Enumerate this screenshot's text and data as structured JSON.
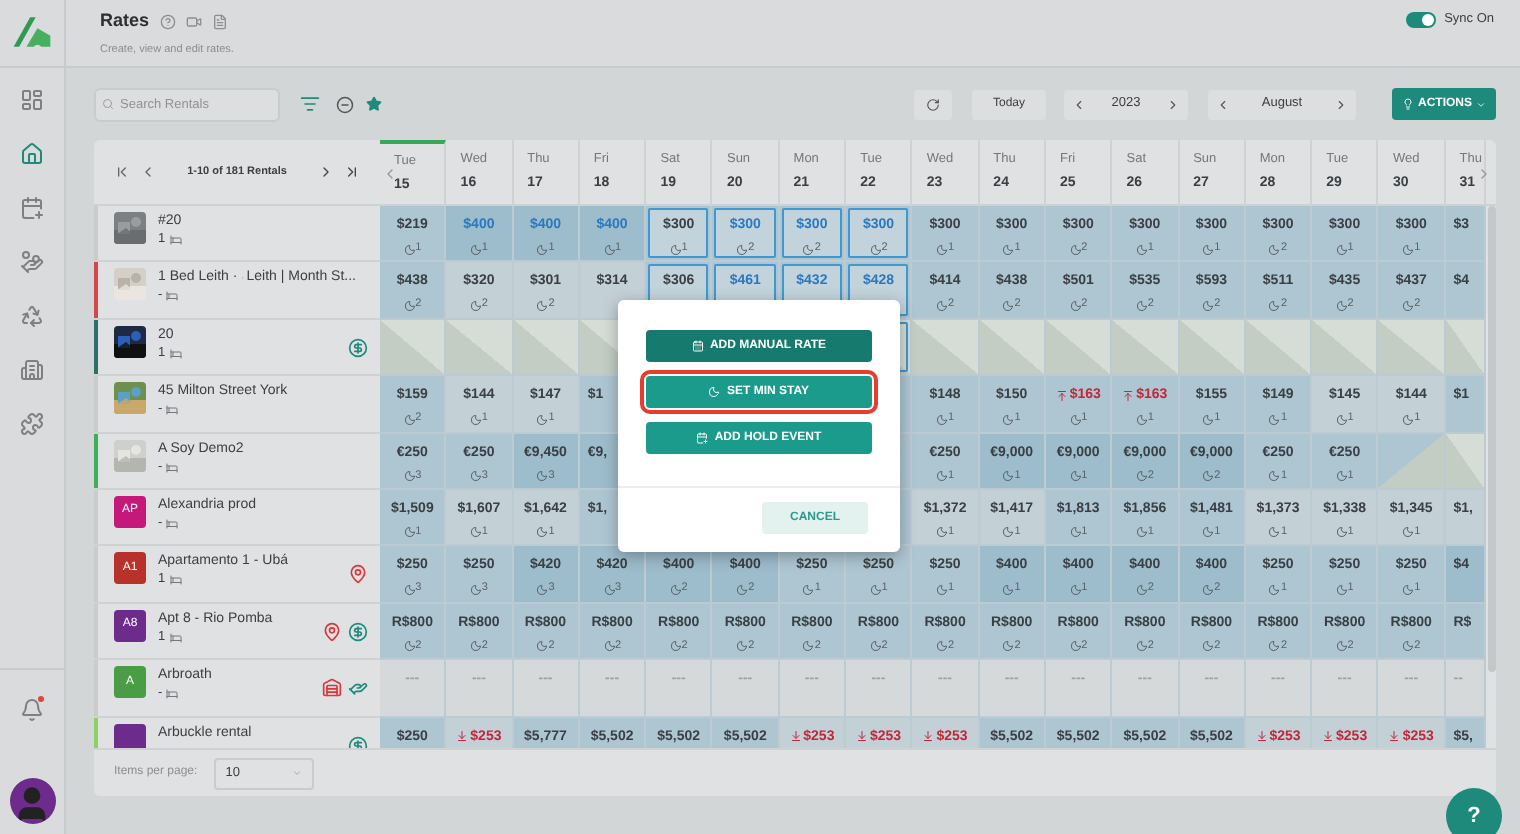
{
  "page": {
    "title": "Rates",
    "subtitle": "Create, view and edit rates.",
    "sync": {
      "label": "Sync On",
      "on": true
    }
  },
  "sidebar": {
    "items": [
      {
        "kind": "dashboard",
        "selected": false
      },
      {
        "kind": "home",
        "selected": true
      },
      {
        "kind": "calendar",
        "selected": false
      },
      {
        "kind": "coins",
        "selected": false
      },
      {
        "kind": "recycle",
        "selected": false
      },
      {
        "kind": "building",
        "selected": false
      },
      {
        "kind": "puzzle",
        "selected": false
      }
    ],
    "notifications": {
      "unread": true
    }
  },
  "toolbar": {
    "search": {
      "placeholder": "Search Rentals"
    },
    "today": "Today",
    "year": "2023",
    "month": "August",
    "actions": "ACTIONS"
  },
  "pager": {
    "label": "1-10 of 181 Rentals"
  },
  "columns": [
    {
      "day": "Tue",
      "date": "15",
      "today": true
    },
    {
      "day": "Wed",
      "date": "16",
      "today": false
    },
    {
      "day": "Thu",
      "date": "17",
      "today": false
    },
    {
      "day": "Fri",
      "date": "18",
      "today": false
    },
    {
      "day": "Sat",
      "date": "19",
      "today": false
    },
    {
      "day": "Sun",
      "date": "20",
      "today": false
    },
    {
      "day": "Mon",
      "date": "21",
      "today": false
    },
    {
      "day": "Tue",
      "date": "22",
      "today": false
    },
    {
      "day": "Wed",
      "date": "23",
      "today": false
    },
    {
      "day": "Thu",
      "date": "24",
      "today": false
    },
    {
      "day": "Fri",
      "date": "25",
      "today": false
    },
    {
      "day": "Sat",
      "date": "26",
      "today": false
    },
    {
      "day": "Sun",
      "date": "27",
      "today": false
    },
    {
      "day": "Mon",
      "date": "28",
      "today": false
    },
    {
      "day": "Tue",
      "date": "29",
      "today": false
    },
    {
      "day": "Wed",
      "date": "30",
      "today": false
    },
    {
      "day": "Thu",
      "date": "31",
      "today": false
    }
  ],
  "rentals": [
    {
      "name": "#20",
      "count": "1",
      "avatar": {
        "kind": "picture"
      },
      "color": "#c9cbcc",
      "cells": [
        {
          "price": "$219",
          "min": "1",
          "kind": "base",
          "selected": false
        },
        {
          "price": "$400",
          "min": "1",
          "kind": "high_manual",
          "selected": false
        },
        {
          "price": "$400",
          "min": "1",
          "kind": "high_manual",
          "selected": false
        },
        {
          "price": "$400",
          "min": "1",
          "kind": "high_manual",
          "selected": false
        },
        {
          "price": "$300",
          "min": "1",
          "kind": "base",
          "selected": true
        },
        {
          "price": "$300",
          "min": "2",
          "kind": "base_manual",
          "selected": true
        },
        {
          "price": "$300",
          "min": "2",
          "kind": "base_manual",
          "selected": true
        },
        {
          "price": "$300",
          "min": "2",
          "kind": "base_manual",
          "selected": true
        },
        {
          "price": "$300",
          "min": "1",
          "kind": "base",
          "selected": false
        },
        {
          "price": "$300",
          "min": "1",
          "kind": "base",
          "selected": false
        },
        {
          "price": "$300",
          "min": "2",
          "kind": "base",
          "selected": false
        },
        {
          "price": "$300",
          "min": "1",
          "kind": "base",
          "selected": false
        },
        {
          "price": "$300",
          "min": "1",
          "kind": "base",
          "selected": false
        },
        {
          "price": "$300",
          "min": "2",
          "kind": "base",
          "selected": false
        },
        {
          "price": "$300",
          "min": "1",
          "kind": "base",
          "selected": false
        },
        {
          "price": "$300",
          "min": "1",
          "kind": "base",
          "selected": false
        },
        {
          "price": "$3",
          "kind": "base",
          "selected": false
        }
      ]
    },
    {
      "name": "1 Bed Leith ·",
      "channel": "Leith | Month St...",
      "count": "-",
      "avatar": {
        "kind": "picture"
      },
      "color": "#d6464a",
      "cells": [
        {
          "price": "$438",
          "min": "2",
          "kind": "base",
          "selected": false
        },
        {
          "price": "$320",
          "min": "2",
          "kind": "light",
          "selected": false
        },
        {
          "price": "$301",
          "min": "2",
          "kind": "light",
          "selected": false
        },
        {
          "price": "$314",
          "kind": "light",
          "selected": false
        },
        {
          "price": "$306",
          "kind": "base",
          "selected": true
        },
        {
          "price": "$461",
          "kind": "base_manual",
          "selected": true
        },
        {
          "price": "$432",
          "kind": "base_manual",
          "selected": true
        },
        {
          "price": "$428",
          "kind": "base_manual",
          "selected": true
        },
        {
          "price": "$414",
          "min": "2",
          "kind": "base",
          "selected": false
        },
        {
          "price": "$438",
          "min": "2",
          "kind": "base",
          "selected": false
        },
        {
          "price": "$501",
          "min": "2",
          "kind": "base",
          "selected": false
        },
        {
          "price": "$535",
          "min": "2",
          "kind": "base",
          "selected": false
        },
        {
          "price": "$593",
          "min": "2",
          "kind": "base",
          "selected": false
        },
        {
          "price": "$511",
          "min": "2",
          "kind": "base",
          "selected": false
        },
        {
          "price": "$435",
          "min": "2",
          "kind": "base",
          "selected": false
        },
        {
          "price": "$437",
          "min": "2",
          "kind": "base",
          "selected": false
        },
        {
          "price": "$4",
          "kind": "base",
          "selected": false
        }
      ]
    },
    {
      "name": "20",
      "count": "1",
      "avatar": {
        "kind": "picture"
      },
      "color": "#2f6e68",
      "badges": [
        {
          "kind": "dollar"
        }
      ],
      "cells": [
        {
          "kind": "hatch",
          "selected": false
        },
        {
          "kind": "hatch",
          "selected": false
        },
        {
          "kind": "hatch",
          "selected": false
        },
        {
          "kind": "hatch",
          "selected": false
        },
        {
          "kind": "hatch",
          "selected": true
        },
        {
          "kind": "hatch",
          "selected": false
        },
        {
          "kind": "hatch",
          "selected": false
        },
        {
          "kind": "hatch",
          "selected": false
        },
        {
          "kind": "hatch",
          "selected": false
        },
        {
          "kind": "hatch",
          "selected": false
        },
        {
          "kind": "hatch",
          "selected": false
        },
        {
          "kind": "hatch",
          "selected": false
        },
        {
          "kind": "hatch",
          "selected": false
        },
        {
          "kind": "hatch",
          "selected": false
        }
      ]
    },
    {
      "name": "45 Milton Street York",
      "count": "-",
      "avatar": {
        "kind": "picture"
      },
      "color": "#c9cbcc",
      "cells": [
        {
          "price": "$159",
          "min": "2",
          "kind": "base",
          "selected": false
        },
        {
          "price": "$144",
          "min": "1",
          "kind": "light",
          "selected": false
        },
        {
          "price": "$147",
          "min": "1",
          "kind": "light",
          "selected": false
        },
        {
          "price": "$1",
          "kind": "base",
          "selected": false
        },
        {
          "price": "$148",
          "min": "1",
          "kind": "base",
          "selected": false
        },
        {
          "price": "$150",
          "min": "1",
          "kind": "base",
          "selected": false
        },
        {
          "price": "$163",
          "min": "1",
          "kind": "base_up",
          "selected": false
        },
        {
          "price": "$163",
          "min": "1",
          "kind": "base_up",
          "selected": false
        },
        {
          "price": "$155",
          "min": "1",
          "kind": "base",
          "selected": false
        },
        {
          "price": "$149",
          "min": "1",
          "kind": "base",
          "selected": false
        },
        {
          "price": "$145",
          "min": "1",
          "kind": "light",
          "selected": false
        },
        {
          "price": "$144",
          "min": "1",
          "kind": "light",
          "selected": false
        },
        {
          "price": "$1",
          "kind": "base",
          "selected": false
        }
      ]
    },
    {
      "name": "A Soy Demo2",
      "count": "-",
      "avatar": {
        "kind": "picture"
      },
      "color": "#3cb15a",
      "cells": [
        {
          "price": "€250",
          "min": "3",
          "kind": "base",
          "selected": false
        },
        {
          "price": "€250",
          "min": "3",
          "kind": "base",
          "selected": false
        },
        {
          "price": "€9,450",
          "min": "3",
          "kind": "high",
          "selected": false
        },
        {
          "price": "€9,",
          "kind": "high",
          "selected": false
        },
        {
          "price": "€250",
          "min": "1",
          "kind": "base",
          "selected": false
        },
        {
          "price": "€9,000",
          "min": "1",
          "kind": "high",
          "selected": false
        },
        {
          "price": "€9,000",
          "min": "1",
          "kind": "high",
          "selected": false
        },
        {
          "price": "€9,000",
          "min": "2",
          "kind": "high",
          "selected": false
        },
        {
          "price": "€9,000",
          "min": "2",
          "kind": "high",
          "selected": false
        },
        {
          "price": "€250",
          "min": "1",
          "kind": "base",
          "selected": false
        },
        {
          "price": "€250",
          "min": "1",
          "kind": "base",
          "selected": false
        },
        {
          "kind": "half_hatch",
          "selected": false
        },
        {
          "kind": "hatch",
          "selected": false
        }
      ]
    },
    {
      "name": "Alexandria prod",
      "count": "-",
      "avatar": {
        "kind": "initials",
        "initials": "AP",
        "color": "#c4197a"
      },
      "color": "#c9cbcc",
      "cells": [
        {
          "price": "$1,509",
          "min": "1",
          "kind": "base",
          "selected": false
        },
        {
          "price": "$1,607",
          "min": "1",
          "kind": "light",
          "selected": false
        },
        {
          "price": "$1,642",
          "min": "1",
          "kind": "light",
          "selected": false
        },
        {
          "price": "$1,",
          "kind": "base",
          "selected": false
        },
        {
          "price": "$1,372",
          "min": "1",
          "kind": "light",
          "selected": false
        },
        {
          "price": "$1,417",
          "min": "1",
          "kind": "light",
          "selected": false
        },
        {
          "price": "$1,813",
          "min": "1",
          "kind": "base",
          "selected": false
        },
        {
          "price": "$1,856",
          "min": "1",
          "kind": "base",
          "selected": false
        },
        {
          "price": "$1,481",
          "min": "1",
          "kind": "base",
          "selected": false
        },
        {
          "price": "$1,373",
          "min": "1",
          "kind": "light",
          "selected": false
        },
        {
          "price": "$1,338",
          "min": "1",
          "kind": "light",
          "selected": false
        },
        {
          "price": "$1,345",
          "min": "1",
          "kind": "light",
          "selected": false
        },
        {
          "price": "$1,",
          "kind": "light",
          "selected": false
        }
      ]
    },
    {
      "name": "Apartamento 1 - Ubá",
      "count": "1",
      "avatar": {
        "kind": "initials",
        "initials": "A1",
        "color": "#b8322c"
      },
      "color": "#c9cbcc",
      "badges": [
        {
          "kind": "pin"
        }
      ],
      "cells": [
        {
          "price": "$250",
          "min": "3",
          "kind": "base",
          "selected": false
        },
        {
          "price": "$250",
          "min": "3",
          "kind": "base",
          "selected": false
        },
        {
          "price": "$420",
          "min": "3",
          "kind": "high",
          "selected": false
        },
        {
          "price": "$420",
          "min": "3",
          "kind": "high",
          "selected": false
        },
        {
          "price": "$400",
          "min": "2",
          "kind": "high",
          "selected": false
        },
        {
          "price": "$400",
          "min": "2",
          "kind": "high",
          "selected": false
        },
        {
          "price": "$250",
          "min": "1",
          "kind": "base",
          "selected": false
        },
        {
          "price": "$250",
          "min": "1",
          "kind": "base",
          "selected": false
        },
        {
          "price": "$250",
          "min": "1",
          "kind": "base",
          "selected": false
        },
        {
          "price": "$400",
          "min": "1",
          "kind": "high",
          "selected": false
        },
        {
          "price": "$400",
          "min": "1",
          "kind": "high",
          "selected": false
        },
        {
          "price": "$400",
          "min": "2",
          "kind": "high",
          "selected": false
        },
        {
          "price": "$400",
          "min": "2",
          "kind": "high",
          "selected": false
        },
        {
          "price": "$250",
          "min": "1",
          "kind": "base",
          "selected": false
        },
        {
          "price": "$250",
          "min": "1",
          "kind": "base",
          "selected": false
        },
        {
          "price": "$250",
          "min": "1",
          "kind": "base",
          "selected": false
        },
        {
          "price": "$4",
          "kind": "high",
          "selected": false
        }
      ]
    },
    {
      "name": "Apt 8 - Rio Pomba",
      "count": "1",
      "avatar": {
        "kind": "initials",
        "initials": "A8",
        "color": "#6d2b8c"
      },
      "color": "#c9cbcc",
      "badges": [
        {
          "kind": "pin"
        },
        {
          "kind": "dollar"
        }
      ],
      "cells": [
        {
          "price": "R$800",
          "min": "2",
          "kind": "base",
          "selected": false
        },
        {
          "price": "R$800",
          "min": "2",
          "kind": "base",
          "selected": false
        },
        {
          "price": "R$800",
          "min": "2",
          "kind": "base",
          "selected": false
        },
        {
          "price": "R$800",
          "min": "2",
          "kind": "base",
          "selected": false
        },
        {
          "price": "R$800",
          "min": "2",
          "kind": "base",
          "selected": false
        },
        {
          "price": "R$800",
          "min": "2",
          "kind": "base",
          "selected": false
        },
        {
          "price": "R$800",
          "min": "2",
          "kind": "base",
          "selected": false
        },
        {
          "price": "R$800",
          "min": "2",
          "kind": "base",
          "selected": false
        },
        {
          "price": "R$800",
          "min": "2",
          "kind": "base",
          "selected": false
        },
        {
          "price": "R$800",
          "min": "2",
          "kind": "base",
          "selected": false
        },
        {
          "price": "R$800",
          "min": "2",
          "kind": "base",
          "selected": false
        },
        {
          "price": "R$800",
          "min": "2",
          "kind": "base",
          "selected": false
        },
        {
          "price": "R$800",
          "min": "2",
          "kind": "base",
          "selected": false
        },
        {
          "price": "R$800",
          "min": "2",
          "kind": "base",
          "selected": false
        },
        {
          "price": "R$800",
          "min": "2",
          "kind": "base",
          "selected": false
        },
        {
          "price": "R$800",
          "min": "2",
          "kind": "base",
          "selected": false
        },
        {
          "price": "R$",
          "kind": "base",
          "selected": false
        }
      ]
    },
    {
      "name": "Arbroath",
      "count": "-",
      "avatar": {
        "kind": "initials",
        "initials": "A",
        "color": "#4a9d45"
      },
      "color": "#c9cbcc",
      "badges": [
        {
          "kind": "house"
        },
        {
          "kind": "payout"
        }
      ],
      "cells": [
        {
          "price": "---",
          "kind": "empty",
          "selected": false
        },
        {
          "price": "---",
          "kind": "empty",
          "selected": false
        },
        {
          "price": "---",
          "kind": "empty",
          "selected": false
        },
        {
          "price": "---",
          "kind": "empty",
          "selected": false
        },
        {
          "price": "---",
          "kind": "empty",
          "selected": false
        },
        {
          "price": "---",
          "kind": "empty",
          "selected": false
        },
        {
          "price": "---",
          "kind": "empty",
          "selected": false
        },
        {
          "price": "---",
          "kind": "empty",
          "selected": false
        },
        {
          "price": "---",
          "kind": "empty",
          "selected": false
        },
        {
          "price": "---",
          "kind": "empty",
          "selected": false
        },
        {
          "price": "---",
          "kind": "empty",
          "selected": false
        },
        {
          "price": "---",
          "kind": "empty",
          "selected": false
        },
        {
          "price": "---",
          "kind": "empty",
          "selected": false
        },
        {
          "price": "---",
          "kind": "empty",
          "selected": false
        },
        {
          "price": "---",
          "kind": "empty",
          "selected": false
        },
        {
          "price": "---",
          "kind": "empty",
          "selected": false
        },
        {
          "price": "--",
          "kind": "empty",
          "selected": false
        }
      ]
    },
    {
      "name": "Arbuckle rental",
      "avatar": {
        "kind": "initials",
        "color": "#6d2b8c"
      },
      "color": "#8fcf63",
      "badges": [
        {
          "kind": "dollar"
        }
      ],
      "cells": [
        {
          "price": "$250",
          "kind": "base",
          "selected": false
        },
        {
          "price": "$253",
          "kind": "light_down",
          "selected": false
        },
        {
          "price": "$5,777",
          "kind": "base",
          "selected": false
        },
        {
          "price": "$5,502",
          "kind": "base",
          "selected": false
        },
        {
          "price": "$5,502",
          "kind": "base",
          "selected": false
        },
        {
          "price": "$5,502",
          "kind": "base",
          "selected": false
        },
        {
          "price": "$253",
          "kind": "light_down",
          "selected": false
        },
        {
          "price": "$253",
          "kind": "light_down",
          "selected": false
        },
        {
          "price": "$253",
          "kind": "light_down",
          "selected": false
        },
        {
          "price": "$5,502",
          "kind": "base",
          "selected": false
        },
        {
          "price": "$5,502",
          "kind": "base",
          "selected": false
        },
        {
          "price": "$5,502",
          "kind": "base",
          "selected": false
        },
        {
          "price": "$5,502",
          "kind": "base",
          "selected": false
        },
        {
          "price": "$253",
          "kind": "light_down",
          "selected": false
        },
        {
          "price": "$253",
          "kind": "light_down",
          "selected": false
        },
        {
          "price": "$253",
          "kind": "light_down",
          "selected": false
        },
        {
          "price": "$5,",
          "kind": "base",
          "selected": false
        }
      ]
    }
  ],
  "footer": {
    "label": "Items per page:",
    "value": "10"
  },
  "help": "?",
  "dialog": {
    "buttons": [
      {
        "kind": "manual_rate",
        "label": "ADD MANUAL RATE",
        "highlighted": false
      },
      {
        "kind": "min_stay",
        "label": "SET MIN STAY",
        "highlighted": true
      },
      {
        "kind": "hold_event",
        "label": "ADD HOLD EVENT",
        "highlighted": false
      }
    ],
    "cancel": "CANCEL"
  }
}
